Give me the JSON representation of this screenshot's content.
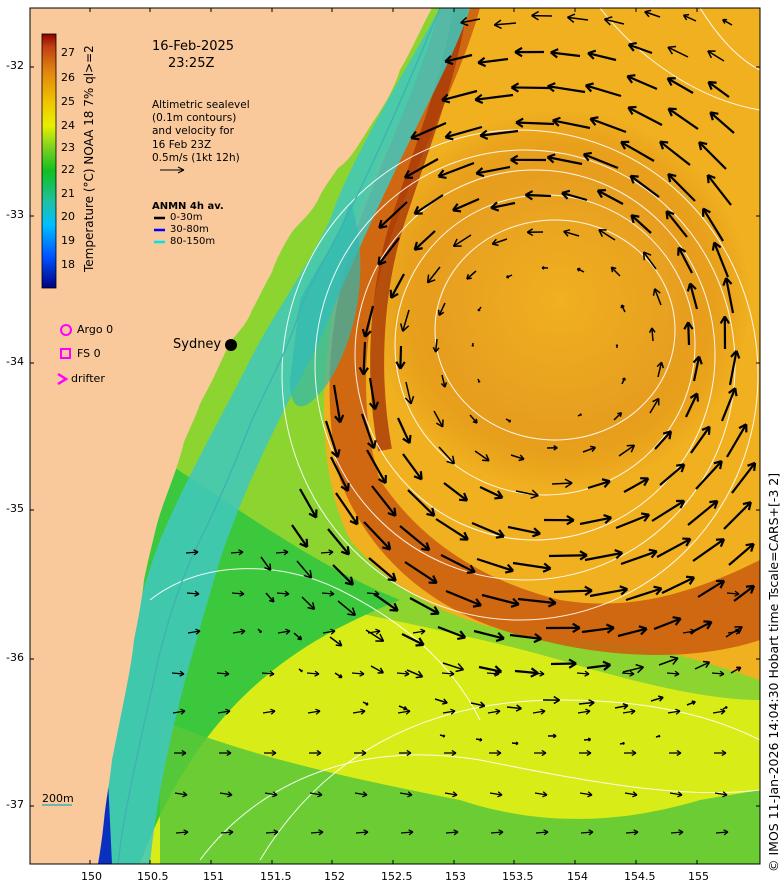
{
  "header": {
    "date": "16-Feb-2025",
    "time": "23:25Z"
  },
  "altimetry_note": "Altimetric sealevel\n(0.1m contours)\nand velocity for\n16 Feb 23Z\n0.5m/s (1kt 12h)",
  "anmn": {
    "title": "ANMN 4h av.",
    "items": [
      {
        "label": "0-30m",
        "color": "#000000"
      },
      {
        "label": "30-80m",
        "color": "#0000ff"
      },
      {
        "label": "80-150m",
        "color": "#00e5e5"
      }
    ]
  },
  "obs_legend": [
    {
      "label": "Argo 0",
      "symbol": "circle",
      "color": "#ff00ff"
    },
    {
      "label": "FS 0",
      "symbol": "square",
      "color": "#ff00ff"
    },
    {
      "label": "drifter",
      "symbol": "chevron",
      "color": "#ff00ff"
    }
  ],
  "place_labels": {
    "sydney": "Sydney"
  },
  "colorbar": {
    "title": "Temperature (°C) NOAA 18 7% ql>=2",
    "ticks": [
      "27",
      "26",
      "25",
      "24",
      "23",
      "22",
      "21",
      "20",
      "19",
      "18"
    ],
    "min": 17.5,
    "max": 27.8
  },
  "axes": {
    "y_ticks": [
      "-32",
      "-33",
      "-34",
      "-35",
      "-36",
      "-37"
    ],
    "x_ticks": [
      "150",
      "150.5",
      "151",
      "151.5",
      "152",
      "152.5",
      "153",
      "153.5",
      "154",
      "154.5",
      "155"
    ],
    "lon_range": [
      149.5,
      155.5
    ],
    "lat_range": [
      -37.4,
      -31.7
    ]
  },
  "isobath_label": "200m",
  "credit": "© IMOS 11-Jan-2026 14:04:30 Hobart time Tscale=CARS+[-3 2]",
  "colors": {
    "land": "#f9c89b",
    "contour": "#ffffff",
    "isobath": "#40b0b0",
    "arrow": "#000000",
    "accent": "#ff00ff"
  }
}
